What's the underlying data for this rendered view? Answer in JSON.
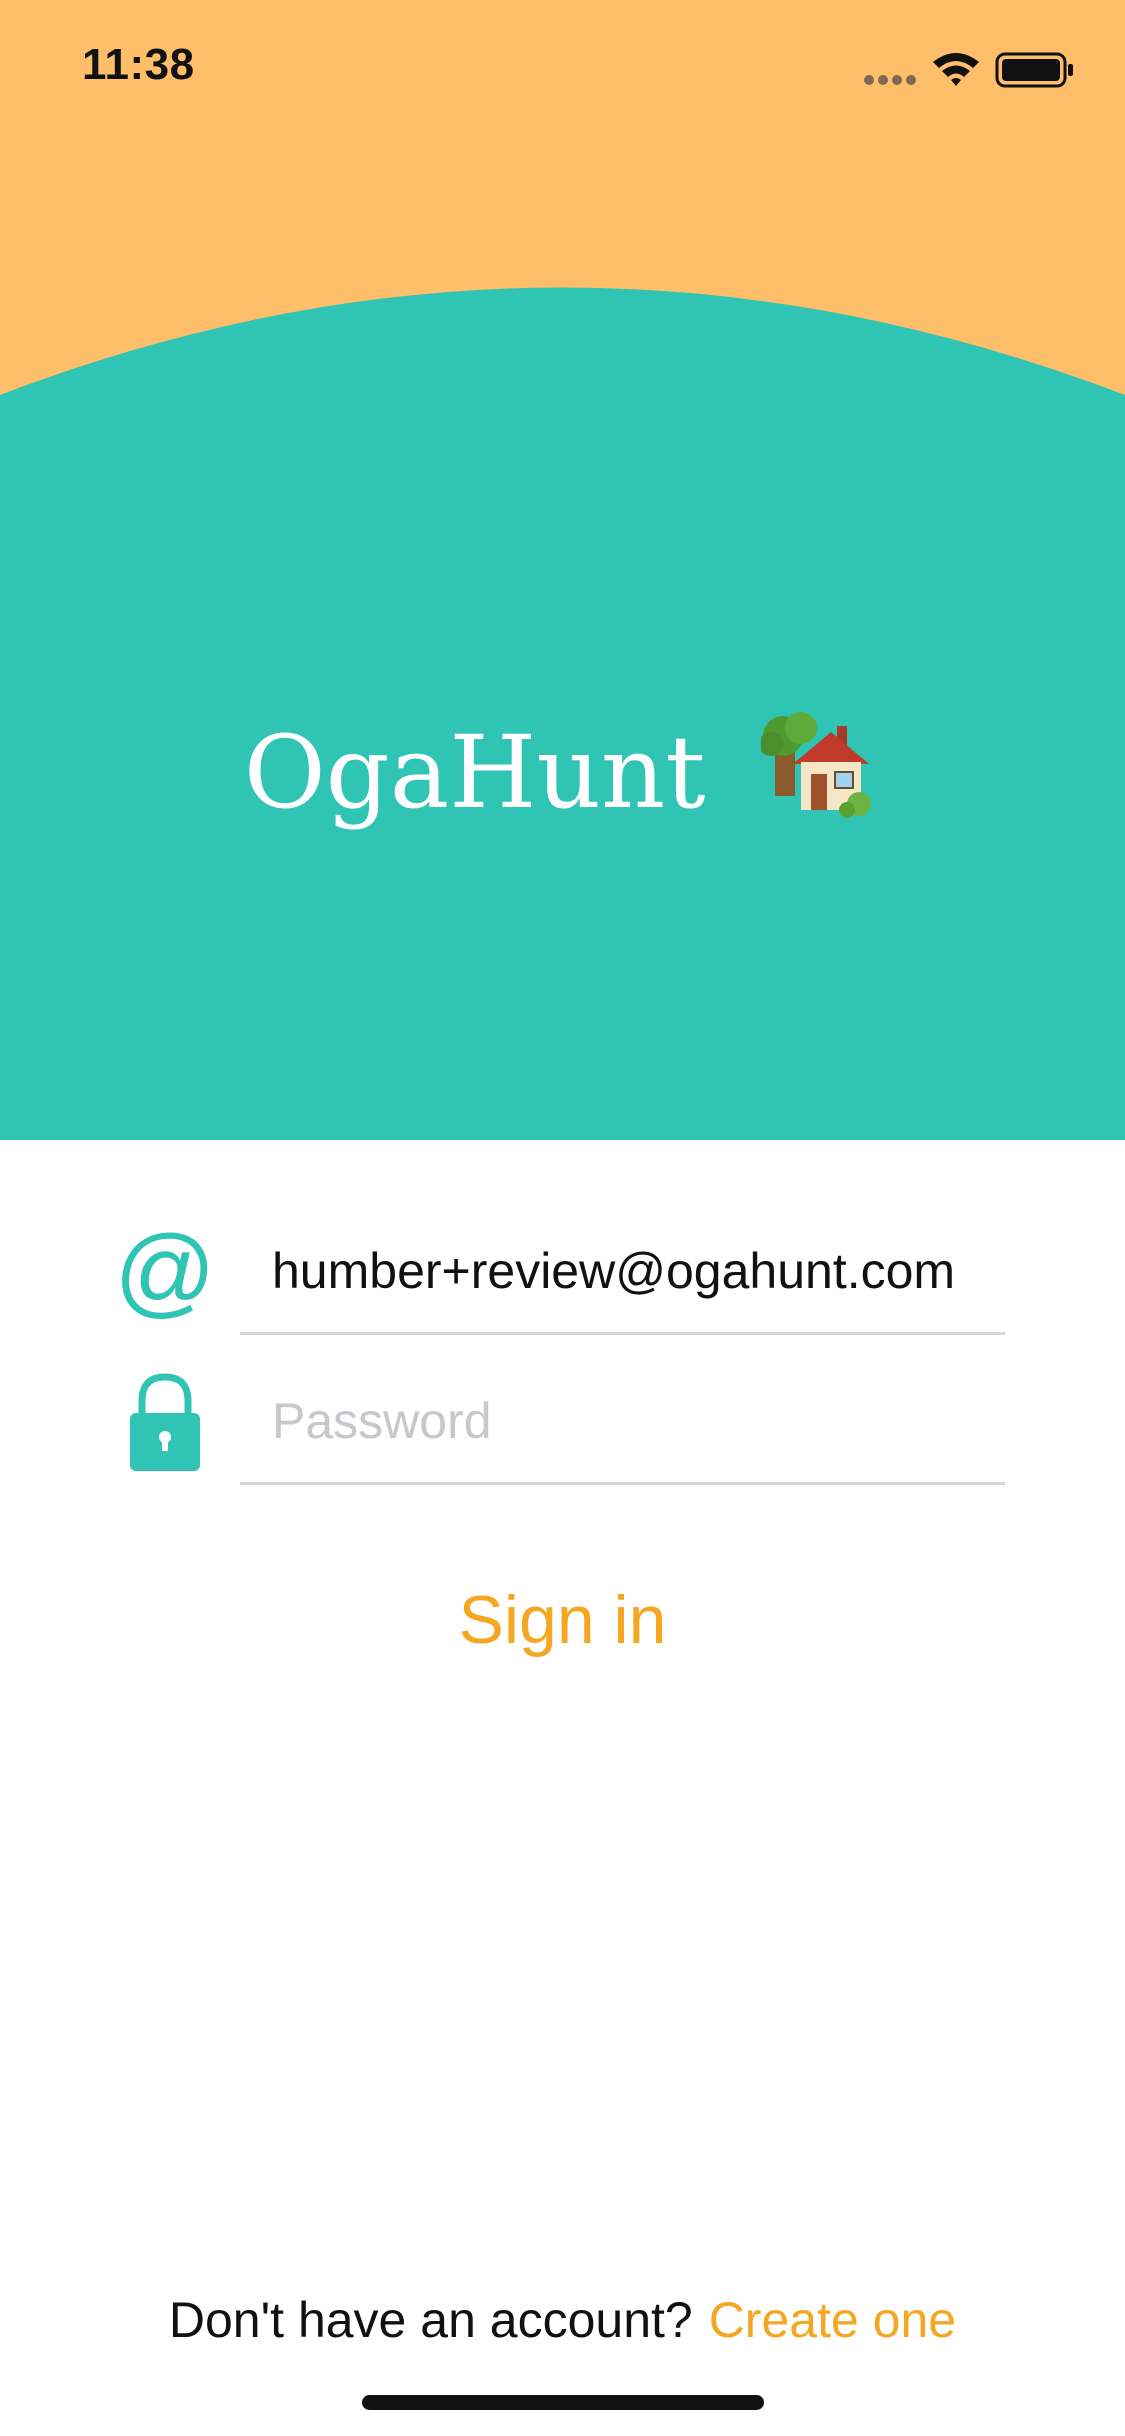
{
  "status_bar": {
    "time": "11:38"
  },
  "header": {
    "title": "OgaHunt",
    "title_icon": "house-with-garden-icon",
    "background_top_color": "#FFBE69",
    "background_bottom_color": "#2FC4B4"
  },
  "form": {
    "email": {
      "icon": "at-sign-icon",
      "value": "humber+review@ogahunt.com",
      "placeholder": ""
    },
    "password": {
      "icon": "lock-icon",
      "value": "",
      "placeholder": "Password"
    },
    "accent_color": "#2FC4B4"
  },
  "signin": {
    "label": "Sign in",
    "color": "#F5A623"
  },
  "footer": {
    "prompt": "Don't have an account?",
    "link": "Create one"
  }
}
